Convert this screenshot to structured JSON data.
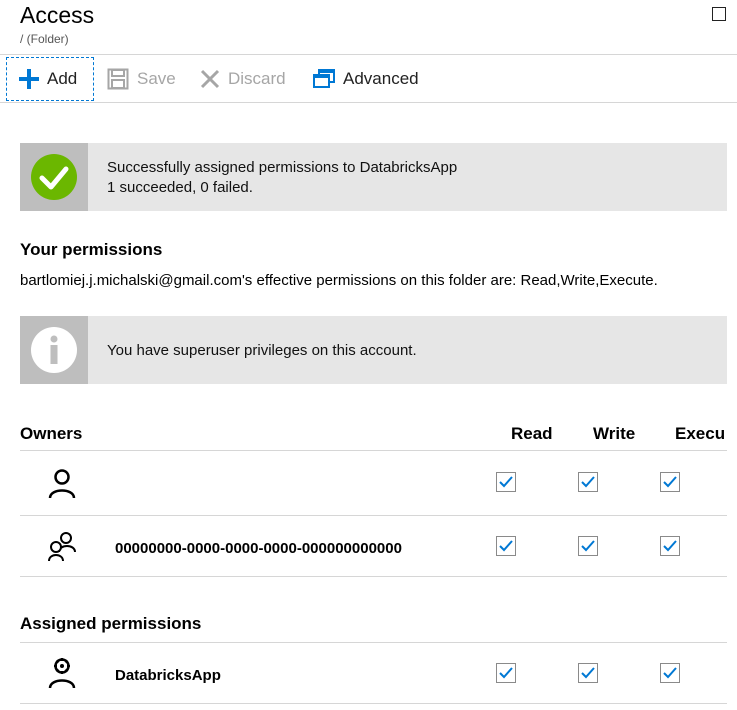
{
  "header": {
    "title": "Access",
    "subtitle": "/ (Folder)"
  },
  "toolbar": {
    "add": "Add",
    "save": "Save",
    "discard": "Discard",
    "advanced": "Advanced"
  },
  "success_banner": {
    "line1": "Successfully assigned permissions to DatabricksApp",
    "line2": "1 succeeded, 0 failed."
  },
  "your_permissions": {
    "heading": "Your permissions",
    "text": "bartlomiej.j.michalski@gmail.com's effective permissions on this folder are: Read,Write,Execute."
  },
  "info_banner": {
    "text": "You have superuser privileges on this account."
  },
  "columns": {
    "owners": "Owners",
    "read": "Read",
    "write": "Write",
    "execute": "Execu"
  },
  "owners": [
    {
      "name": "",
      "icon": "user-icon",
      "read": true,
      "write": true,
      "execute": true
    },
    {
      "name": "00000000-0000-0000-0000-000000000000",
      "icon": "group-icon",
      "read": true,
      "write": true,
      "execute": true
    }
  ],
  "assigned": {
    "heading": "Assigned permissions",
    "rows": [
      {
        "name": "DatabricksApp",
        "icon": "app-user-icon",
        "read": true,
        "write": true,
        "execute": true
      }
    ]
  },
  "colors": {
    "accent": "#0078d4",
    "success": "#6bb700",
    "banner_bg": "#e6e6e6",
    "banner_side": "#bebebe"
  }
}
